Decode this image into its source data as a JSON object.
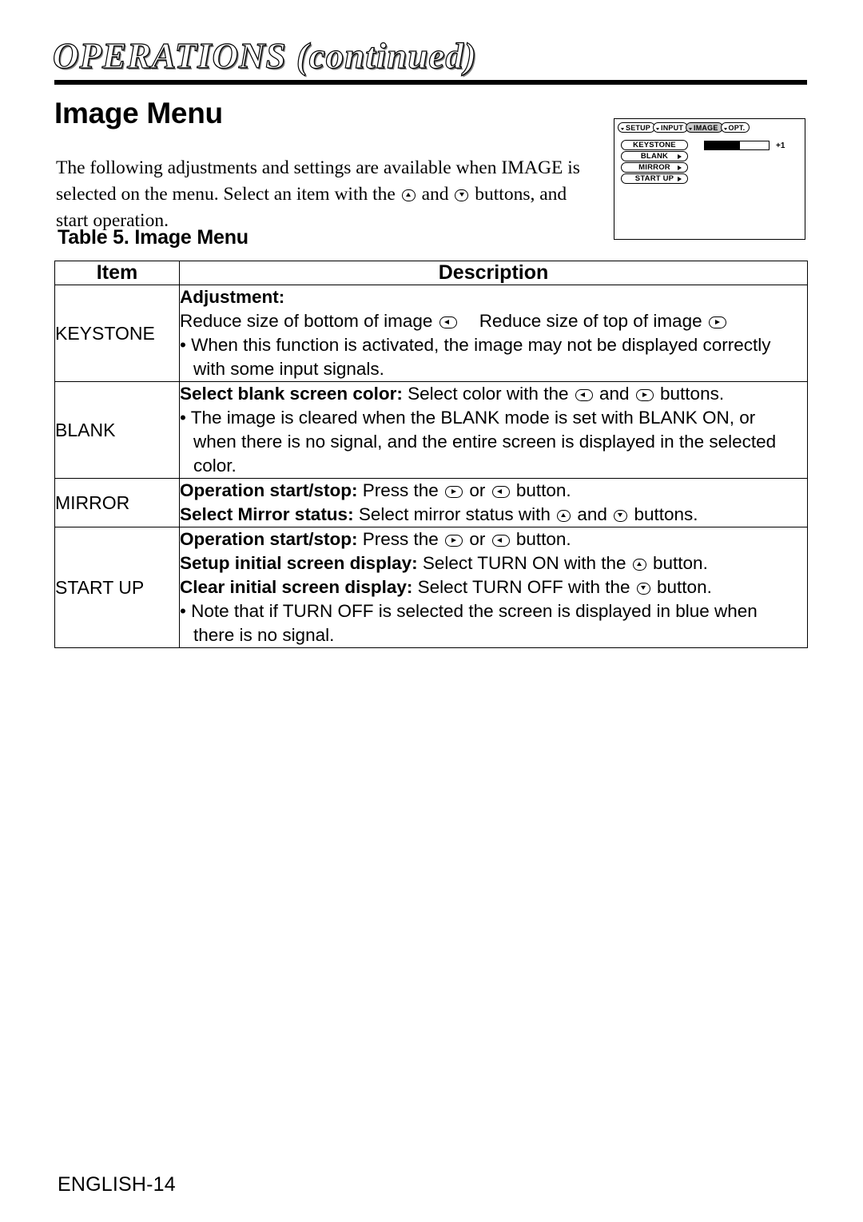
{
  "header": {
    "chapter_title": "OPERATIONS (continued)",
    "section_heading": "Image Menu"
  },
  "intro": {
    "part1": "The following adjustments and settings are available when IMAGE is selected on the menu. Select an item with the ",
    "part2": " and ",
    "part3": " buttons, and start operation."
  },
  "osd": {
    "tabs": [
      {
        "label": "SETUP",
        "selected": false
      },
      {
        "label": "INPUT",
        "selected": false
      },
      {
        "label": "IMAGE",
        "selected": true
      },
      {
        "label": "OPT.",
        "selected": false
      }
    ],
    "items": [
      {
        "label": "KEYSTONE",
        "has_arrow": false
      },
      {
        "label": "BLANK",
        "has_arrow": true
      },
      {
        "label": "MIRROR",
        "has_arrow": true
      },
      {
        "label": "START UP",
        "has_arrow": true
      }
    ],
    "bar": {
      "value_label": "+1",
      "fill_percent": 55
    }
  },
  "table": {
    "caption": "Table 5. Image Menu",
    "headers": {
      "item": "Item",
      "description": "Description"
    },
    "rows": [
      {
        "item": "KEYSTONE",
        "l1_bold": "Adjustment:",
        "l2_a": "Reduce size of bottom of image",
        "l2_b": "Reduce size of top of image",
        "l3": "• When this function is activated, the image may not be displayed correctly",
        "l4": "with some input signals."
      },
      {
        "item": "BLANK",
        "l1_bold": "Select blank screen color:",
        "l1_a": " Select color with the ",
        "l1_b": " and ",
        "l1_c": " buttons.",
        "l2": "• The image is cleared when the BLANK mode is set with BLANK ON, or",
        "l3": "when there is no signal, and the entire screen is displayed in the selected",
        "l4": "color."
      },
      {
        "item": "MIRROR",
        "l1_bold": "Operation start/stop:",
        "l1_a": " Press the ",
        "l1_b": " or ",
        "l1_c": " button.",
        "l2_bold": "Select Mirror status:",
        "l2_a": " Select mirror status with ",
        "l2_b": " and ",
        "l2_c": " buttons."
      },
      {
        "item": "START UP",
        "l1_bold": "Operation start/stop:",
        "l1_a": " Press the ",
        "l1_b": " or ",
        "l1_c": " button.",
        "l2_bold": "Setup initial screen display:",
        "l2_a": " Select TURN ON with the ",
        "l2_b": " button.",
        "l3_bold": "Clear initial screen display:",
        "l3_a": " Select TURN OFF with the ",
        "l3_b": " button.",
        "l4": "• Note that if TURN OFF is selected the screen is displayed in blue when",
        "l5": "there is no signal."
      }
    ]
  },
  "footer": {
    "page_label": "ENGLISH-14"
  }
}
